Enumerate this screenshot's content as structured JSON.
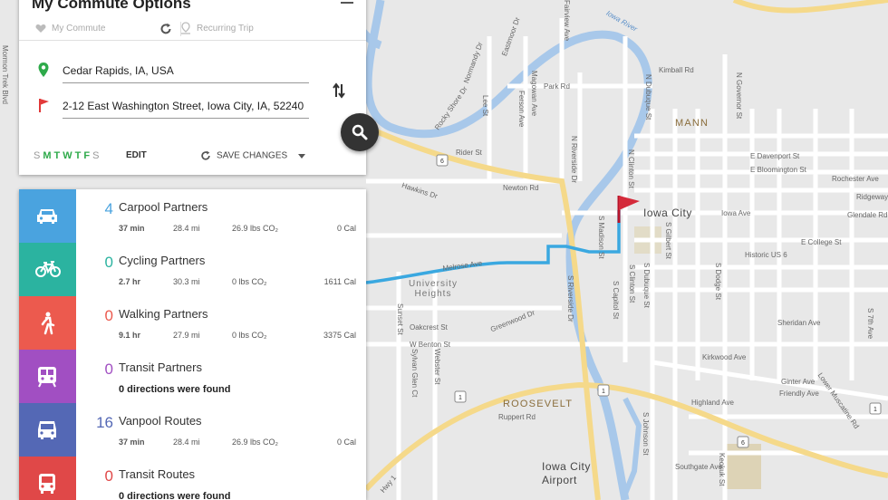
{
  "header": {
    "title": "My Commute Options",
    "tab_my_commute": "My Commute",
    "tab_recurring": "Recurring Trip"
  },
  "route": {
    "origin": "Cedar Rapids, IA, USA",
    "destination": "2-12 East Washington Street, Iowa City, IA, 52240"
  },
  "schedule": {
    "days": [
      {
        "letter": "S",
        "active": false
      },
      {
        "letter": "M",
        "active": true
      },
      {
        "letter": "T",
        "active": true
      },
      {
        "letter": "W",
        "active": true
      },
      {
        "letter": "T",
        "active": true
      },
      {
        "letter": "F",
        "active": true
      },
      {
        "letter": "S",
        "active": false
      }
    ],
    "edit_label": "EDIT",
    "save_label": "SAVE CHANGES"
  },
  "options": [
    {
      "name": "Carpool Partners",
      "count": "4",
      "color": "#4aa3df",
      "icon": "car-icon",
      "time": "37 min",
      "distance": "28.4 mi",
      "co2": "26.9 lbs CO₂",
      "cal": "0 Cal"
    },
    {
      "name": "Cycling Partners",
      "count": "0",
      "color": "#2bb3a0",
      "icon": "bicycle-icon",
      "time": "2.7 hr",
      "distance": "30.3 mi",
      "co2": "0 lbs CO₂",
      "cal": "1611 Cal"
    },
    {
      "name": "Walking Partners",
      "count": "0",
      "color": "#ec5a4e",
      "icon": "walking-icon",
      "time": "9.1 hr",
      "distance": "27.9 mi",
      "co2": "0 lbs CO₂",
      "cal": "3375 Cal"
    },
    {
      "name": "Transit Partners",
      "count": "0",
      "color": "#a14fc2",
      "icon": "train-icon",
      "message": "0 directions were found"
    },
    {
      "name": "Vanpool Routes",
      "count": "16",
      "color": "#5468b5",
      "icon": "van-icon",
      "time": "37 min",
      "distance": "28.4 mi",
      "co2": "26.9 lbs CO₂",
      "cal": "0 Cal"
    },
    {
      "name": "Transit Routes",
      "count": "0",
      "color": "#e04848",
      "icon": "bus-icon",
      "message": "0 directions were found"
    }
  ],
  "map": {
    "city_label": "Iowa City",
    "neighborhoods": [
      "MANN",
      "University Heights",
      "ROOSEVELT"
    ],
    "airport": "Iowa City Airport",
    "river": "Iowa River",
    "streets": [
      "Park Rd",
      "Rider St",
      "Newton Rd",
      "Hawkins Dr",
      "Melrose Ave",
      "Oakcrest St",
      "W Benton St",
      "Greenwood Dr",
      "Ruppert Rd",
      "Kimball Rd",
      "Highland Ave",
      "Southgate Ave",
      "Kirkwood Ave",
      "Sheridan Ave",
      "Ginter Ave",
      "Friendly Ave",
      "Iowa Ave",
      "E College St",
      "Glendale Rd",
      "Ridgeway Dr",
      "Rochester Ave",
      "E Davenport St",
      "E Bloomington St",
      "Historic US 6",
      "S Riverside Dr",
      "N Dubuque St",
      "N Clinton St",
      "N Governor St",
      "S Gilbert St",
      "S Dodge St",
      "S Madison St",
      "S Capitol St",
      "S Clinton St",
      "S Dubuque St",
      "Sunset St",
      "Keokuk St",
      "Lower Muscatine Rd",
      "Mormon Trek Blvd",
      "Magowan Ave",
      "Ferson Ave",
      "Normandy Dr",
      "Eastmoor Dr",
      "Rocky Shore Dr",
      "Lee St",
      "N Riverside Dr",
      "S Johnson St",
      "S 7th Ave",
      "Sylvan Glen Ct",
      "Webster St",
      "Hwy 1",
      "Fairview Ave"
    ],
    "route_numbers": [
      "6",
      "1",
      "1",
      "1",
      "6"
    ]
  }
}
